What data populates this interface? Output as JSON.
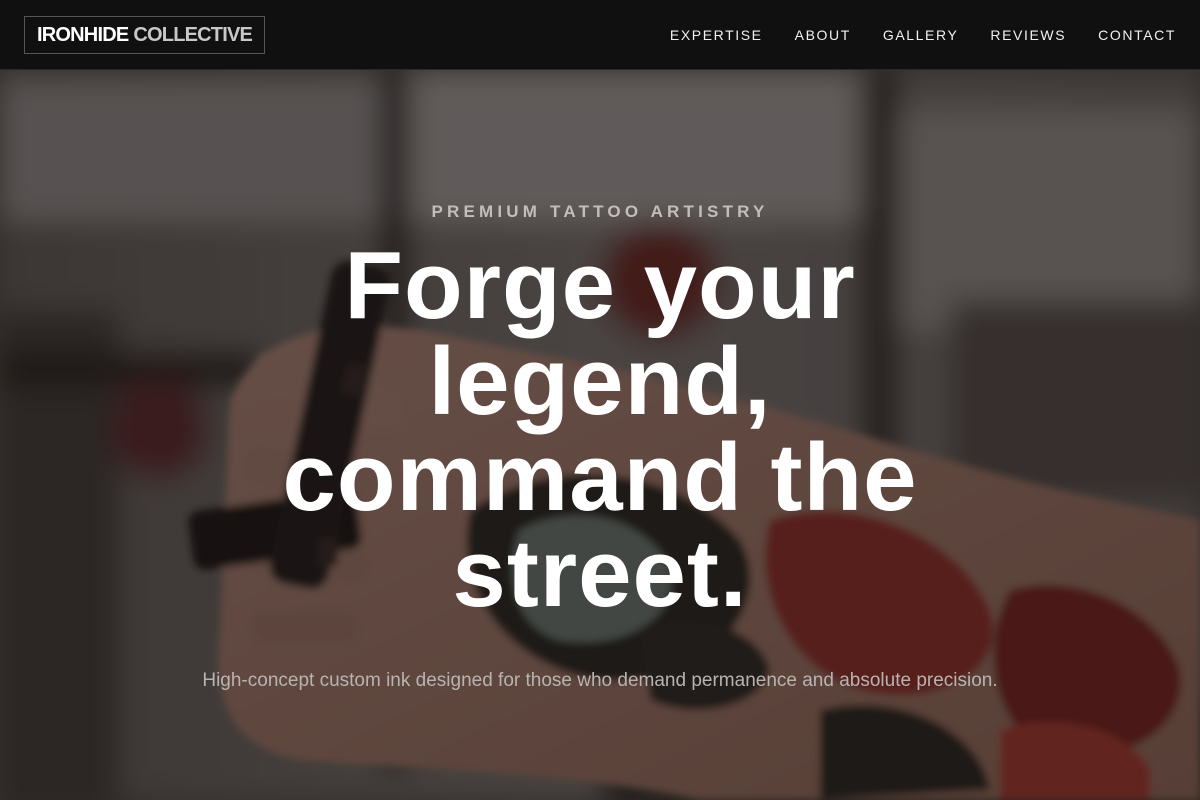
{
  "brand": {
    "name_primary": "IRONHIDE",
    "name_secondary": "COLLECTIVE"
  },
  "nav": {
    "items": [
      {
        "label": "EXPERTISE"
      },
      {
        "label": "ABOUT"
      },
      {
        "label": "GALLERY"
      },
      {
        "label": "REVIEWS"
      },
      {
        "label": "CONTACT"
      }
    ]
  },
  "hero": {
    "eyebrow": "PREMIUM TATTOO ARTISTRY",
    "headline": "Forge your legend, command the street.",
    "subtitle": "High-concept custom ink designed for those who demand permanence and absolute precision."
  },
  "colors": {
    "nav_background": "#101010",
    "headline": "#ffffff",
    "eyebrow": "#c2bebd",
    "subtitle": "#b8b3b1"
  }
}
